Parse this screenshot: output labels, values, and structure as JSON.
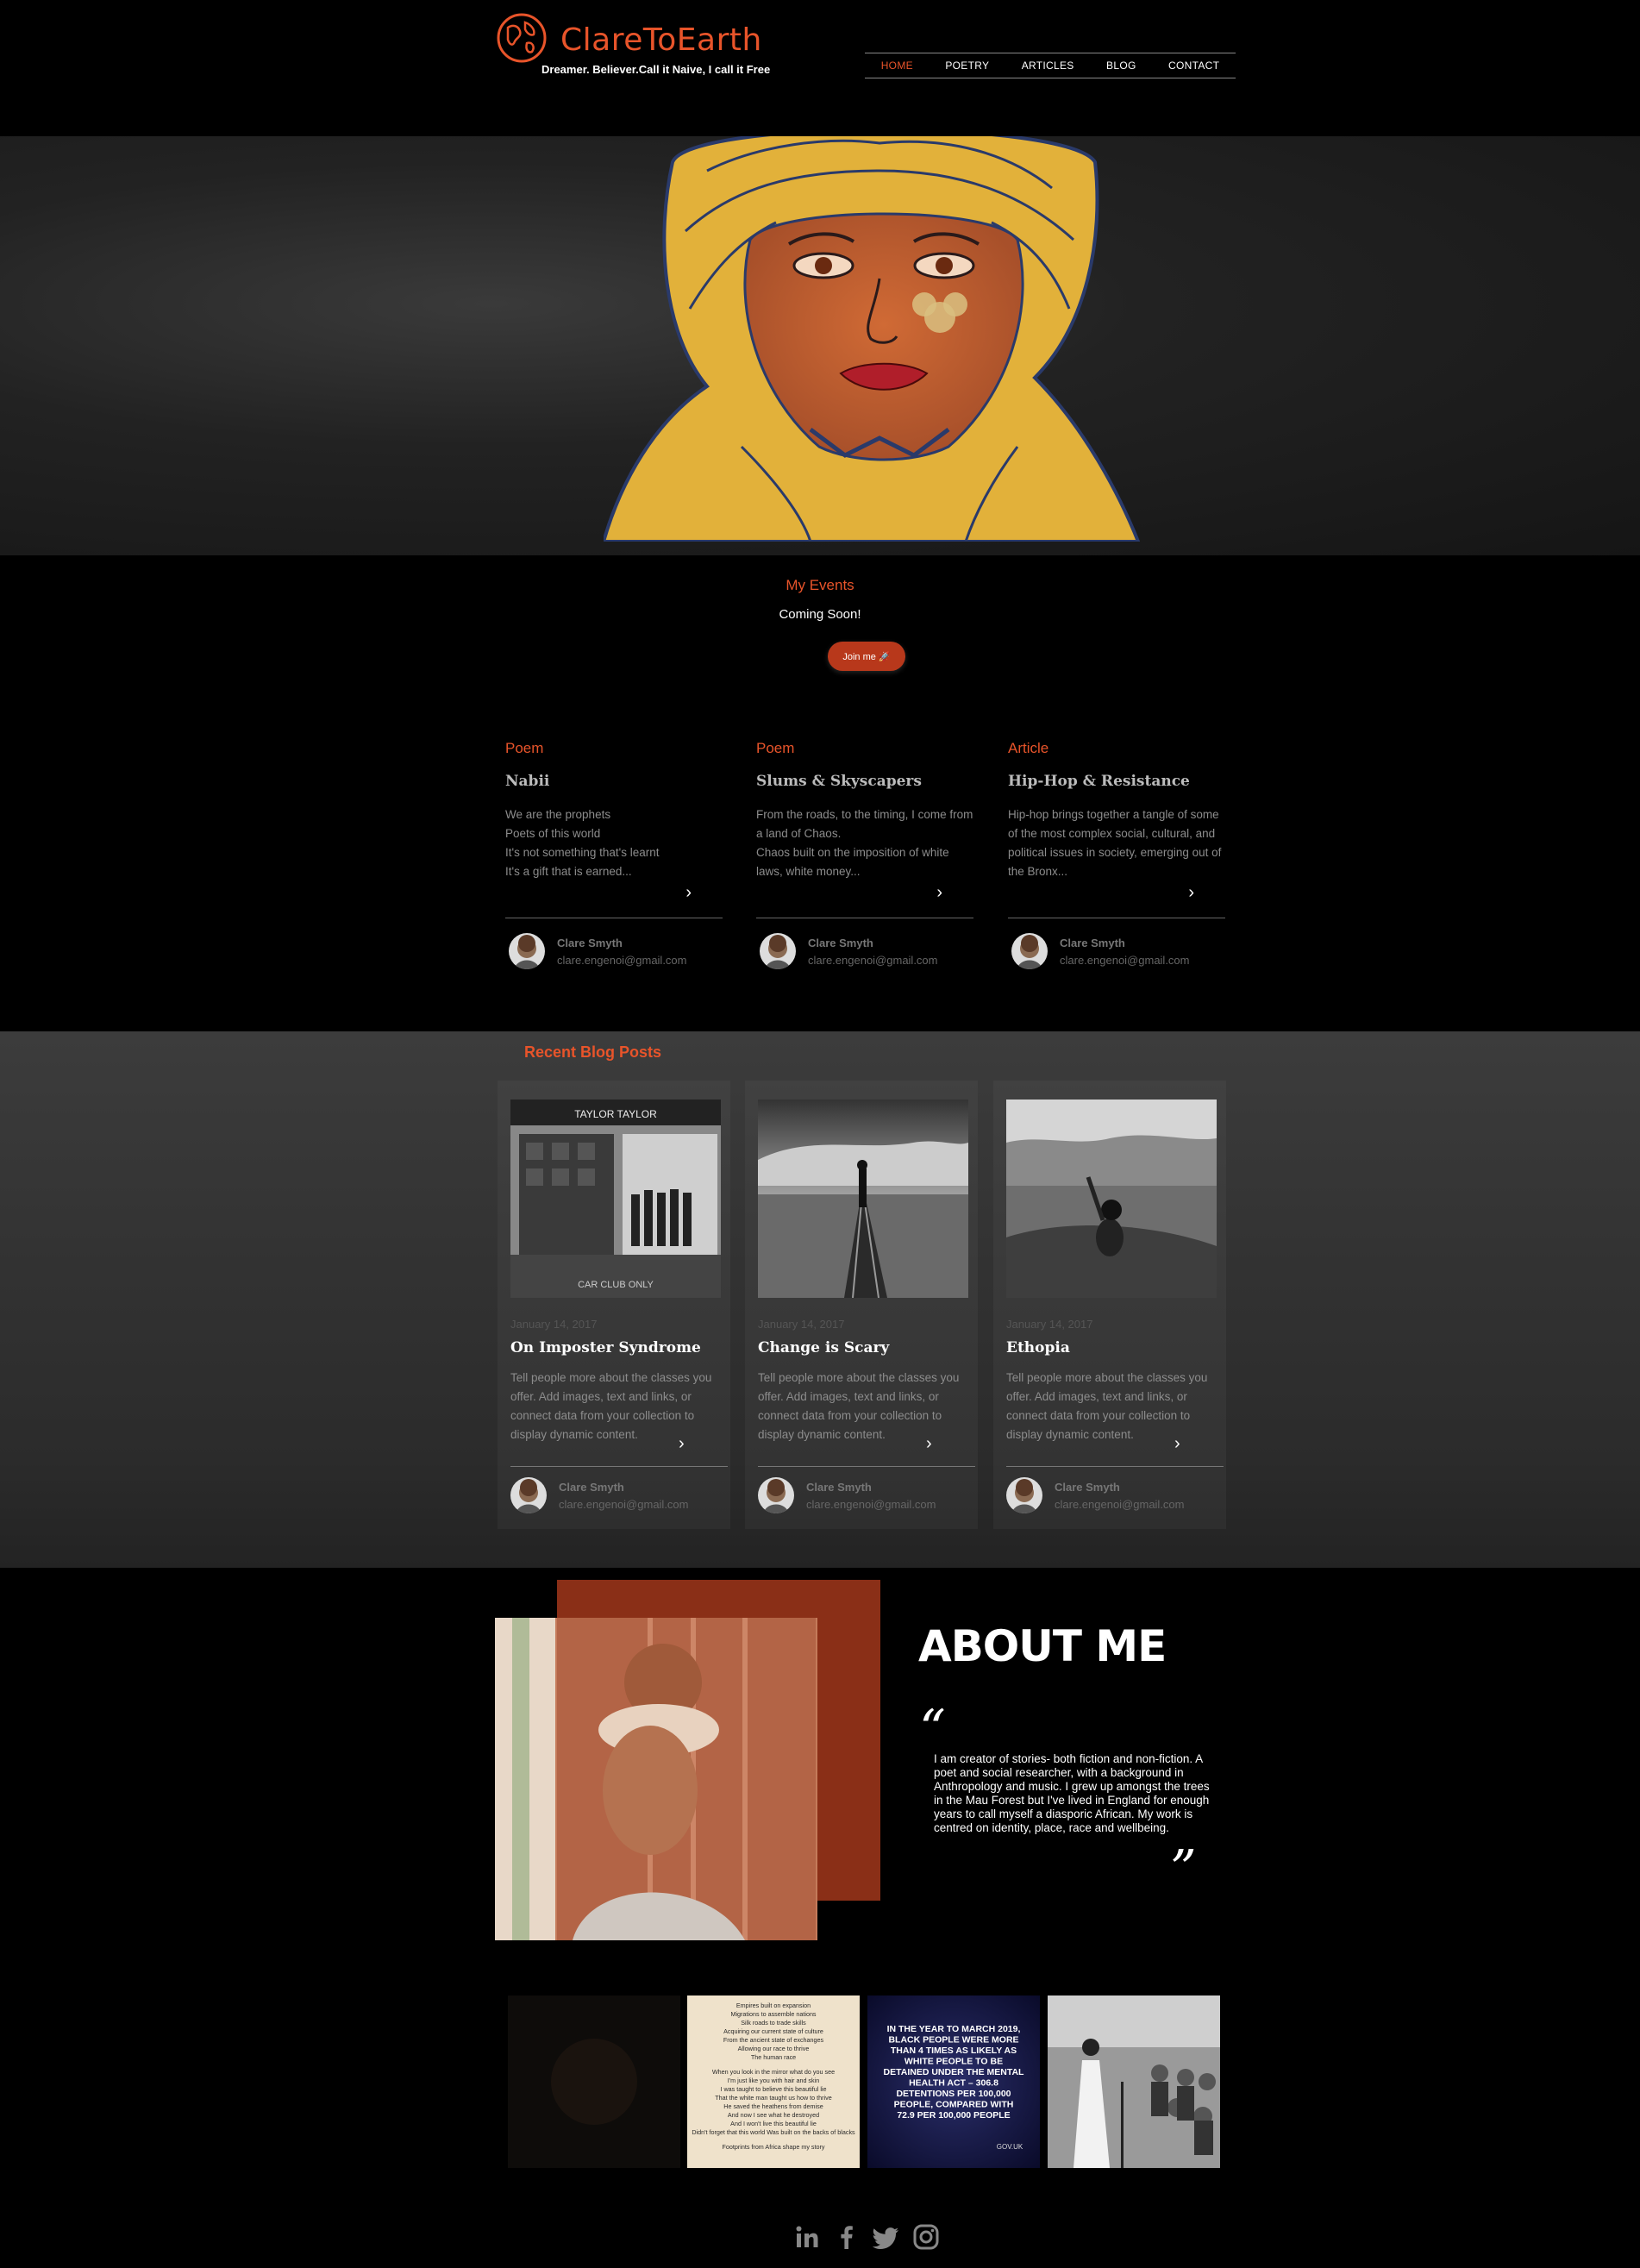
{
  "header": {
    "site_title": "ClareToEarth",
    "tagline": "Dreamer. Believer.Call it Naive, I call it Free",
    "nav": [
      "HOME",
      "POETRY",
      "ARTICLES",
      "BLOG",
      "CONTACT"
    ],
    "active_nav": "HOME",
    "brand_color": "#e8542a"
  },
  "events": {
    "title": "My Events",
    "subtitle": "Coming Soon!",
    "button_label": "Join me 🚀"
  },
  "posts": [
    {
      "category": "Poem",
      "title": "Nabii",
      "excerpt": "We are the prophets\n Poets of this world\nIt's not something that's learnt\nIt's a gift that is earned...",
      "author": "Clare Smyth",
      "email": "clare.engenoi@gmail.com"
    },
    {
      "category": "Poem",
      "title": "Slums & Skyscapers",
      "excerpt": "From the roads, to the timing, I come from a land of Chaos.\nChaos built on the imposition of white laws, white money...",
      "author": "Clare Smyth",
      "email": "clare.engenoi@gmail.com"
    },
    {
      "category": "Article",
      "title": "Hip-Hop & Resistance",
      "excerpt": "Hip-hop brings together a tangle of some of the most complex social, cultural, and political issues in society, emerging out of the Bronx...",
      "author": "Clare Smyth",
      "email": "clare.engenoi@gmail.com"
    }
  ],
  "blog": {
    "heading": "Recent Blog Posts",
    "cards": [
      {
        "date": "January 14, 2017",
        "title": "On Imposter Syndrome",
        "excerpt": "Tell people more about the classes you offer. Add images, text and links, or connect data from your collection to display dynamic content.",
        "author": "Clare Smyth",
        "email": "clare.engenoi@gmail.com",
        "image_sign": "TAYLOR TAYLOR",
        "image_floor_text": "CAR  CLUB ONLY"
      },
      {
        "date": "January 14, 2017",
        "title": "Change is Scary",
        "excerpt": "Tell people more about the classes you offer. Add images, text and links, or connect data from your collection to display dynamic content.",
        "author": "Clare Smyth",
        "email": "clare.engenoi@gmail.com"
      },
      {
        "date": "January 14, 2017",
        "title": "Ethopia",
        "excerpt": "Tell people more about the classes you offer. Add images, text and links, or connect data from your collection to display dynamic content.",
        "author": "Clare Smyth",
        "email": "clare.engenoi@gmail.com"
      }
    ]
  },
  "about": {
    "title": "ABOUT ME",
    "quote_open": "“",
    "quote_close": "”",
    "text": "I am creator of stories- both fiction and non-fiction. A poet and social researcher, with a background in Anthropology and music. I grew up amongst the trees in the Mau Forest but I've lived in England for enough years to call myself a diasporic African. My work is centred on identity, place, race and wellbeing."
  },
  "gallery": {
    "poem_lines": [
      "Empires built on expansion",
      "Migrations to assemble nations",
      "Silk roads to trade skills",
      "Acquiring our current state of culture",
      "From the ancient state of exchanges",
      "Allowing our race to thrive",
      "The human race",
      "",
      "When you look in the mirror what do you see",
      "I'm just like you with hair and skin",
      "I was taught to believe this beautiful lie",
      "That the white man taught us how to thrive",
      "He saved the heathens from demise",
      "And now I see what he destroyed",
      "And I won't live this beautiful lie",
      "Didn't forget that this world Was built on the backs of blacks",
      "",
      "Footprints from Africa shape my story"
    ],
    "stat_lines": [
      "IN THE YEAR TO MARCH 2019,",
      "BLACK PEOPLE WERE MORE",
      "THAN 4 TIMES AS LIKELY AS",
      "WHITE PEOPLE TO BE",
      "DETAINED UNDER THE MENTAL",
      "HEALTH ACT – 306.8",
      "DETENTIONS PER 100,000",
      "PEOPLE, COMPARED WITH",
      "72.9 PER 100,000 PEOPLE"
    ],
    "stat_source": "GOV.UK"
  },
  "social": [
    "linkedin-icon",
    "facebook-icon",
    "twitter-icon",
    "instagram-icon"
  ]
}
